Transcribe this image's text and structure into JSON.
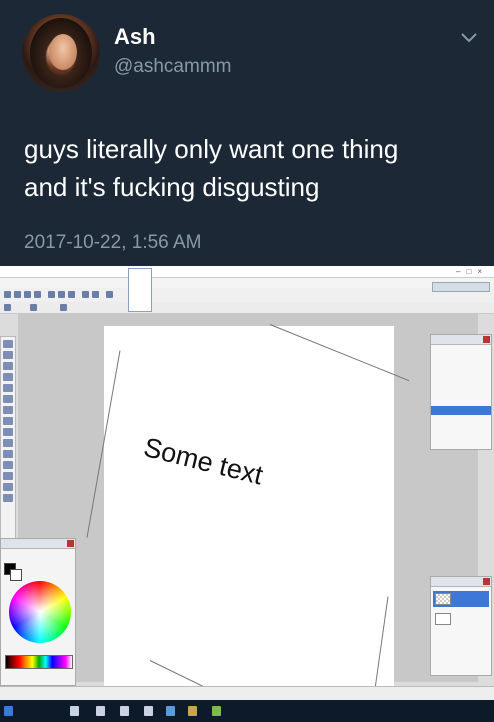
{
  "tweet": {
    "display_name": "Ash",
    "handle": "@ashcammm",
    "text_line1": "guys literally only want one thing",
    "text_line2": "and it's fucking disgusting",
    "timestamp": "2017-10-22, 1:56 AM",
    "menu_icon": "chevron-down-icon"
  },
  "app": {
    "canvas_text": "Some text",
    "colors": {
      "tweet_bg": "#1c2836",
      "handle_gray": "#8899a6",
      "selection_blue": "#3d78d8",
      "taskbar": "#0d1a2a"
    }
  }
}
